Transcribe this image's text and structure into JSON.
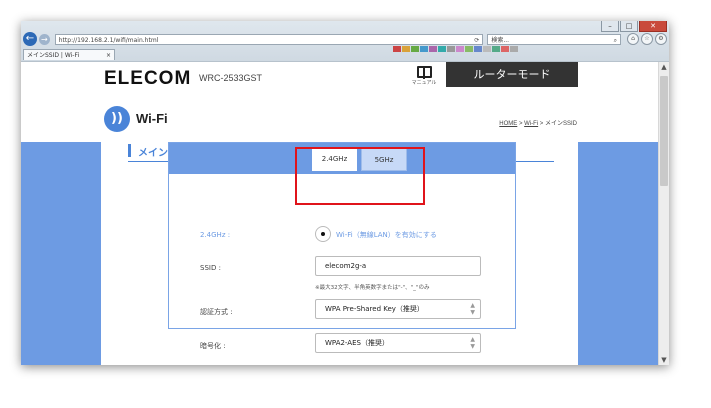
{
  "browser": {
    "address": "http://192.168.2.1/wifi/main.html",
    "reload_glyph": "⟳",
    "search_placeholder": "検索...",
    "tab_title": "メインSSID | Wi-Fi",
    "tab_close": "×",
    "window_buttons": {
      "minimize": "–",
      "maximize": "□",
      "close": "✕"
    },
    "icons": [
      "home-icon",
      "star-icon",
      "gear-icon"
    ]
  },
  "header": {
    "brand": "ELECOM",
    "model": "WRC-2533GST",
    "manual_label": "マニュアル",
    "mode_label": "ルーターモード"
  },
  "page": {
    "wifi_title": "Wi-Fi",
    "wifi_icon": "wifi-signal-icon",
    "breadcrumb": {
      "home": "HOME",
      "sep1": " > ",
      "wifi": "Wi-Fi",
      "sep2": " > ",
      "current": "メインSSID"
    },
    "section_title": "メインSSID"
  },
  "tabs": {
    "band24": "2.4GHz",
    "band5": "5GHz",
    "active": "2.4GHz"
  },
  "form": {
    "band_label": "2.4GHz :",
    "enable_label": "Wi-Fi（無線LAN）を有効にする",
    "ssid_label": "SSID :",
    "ssid_value": "elecom2g-a",
    "ssid_hint": "※最大32文字、半角英数字または\"-\"、\"_\"のみ",
    "auth_label": "認証方式 :",
    "auth_value": "WPA Pre-Shared Key（推奨）",
    "enc_label": "暗号化 :",
    "enc_value": "WPA2-AES（推奨）"
  },
  "colors": {
    "accent": "#4a84d8",
    "panel": "#6d9be3",
    "highlight": "#e0141b",
    "mode_tab": "#333333"
  }
}
